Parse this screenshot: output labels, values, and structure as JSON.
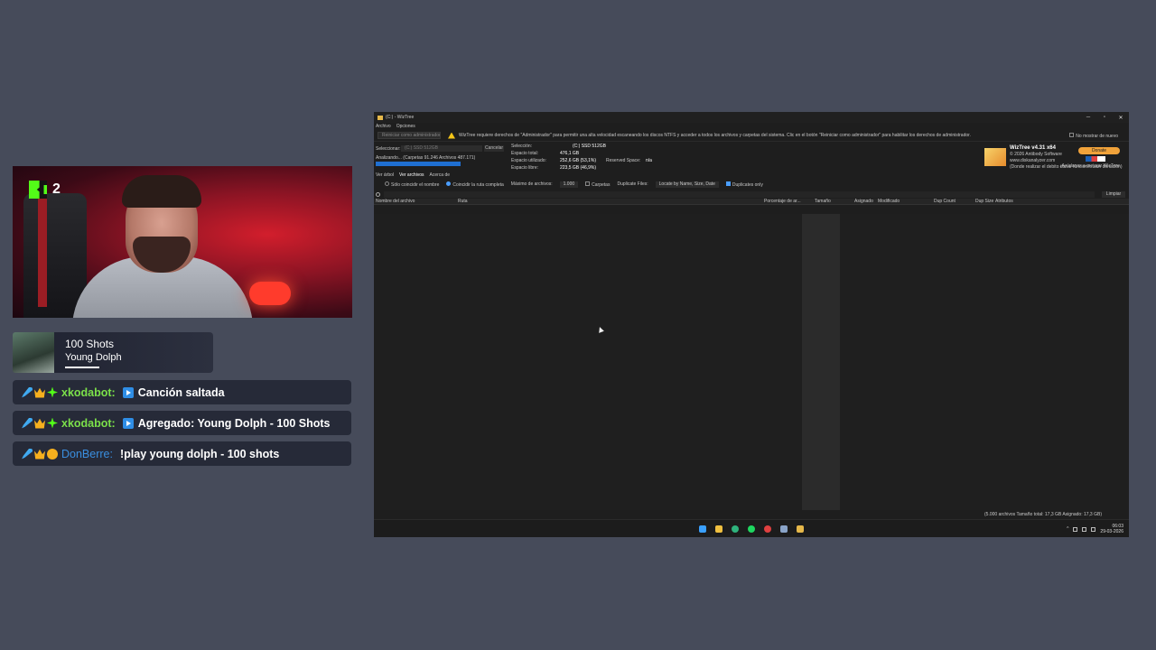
{
  "webcam": {
    "viewer_count": "2"
  },
  "now_playing": {
    "song": "100 Shots",
    "artist": "Young Dolph"
  },
  "chat": [
    {
      "user": "xkodabot:",
      "user_color": "#7be04a",
      "message": "Canción saltada",
      "icon": "skip-icon"
    },
    {
      "user": "xkodabot:",
      "user_color": "#7be04a",
      "message": "Agregado: Young Dolph - 100 Shots",
      "icon": "play-icon"
    },
    {
      "user": "DonBerre:",
      "user_color": "#3a8fe0",
      "message": "!play young dolph - 100 shots",
      "icon": ""
    }
  ],
  "window": {
    "title": "(C:) - WizTree",
    "drive_label": "(C:)",
    "app_name": "WizTree",
    "menu": [
      "Archivo",
      "Opciones"
    ],
    "admin_button": "Reiniciar como administrador",
    "admin_warning": "WizTree requiere derechos de \"Administrador\" para permitir una alta velocidad escaneando los discos NTFS y acceder a todos los archivos y carpetas del sistema. Clic en el botón \"Reiniciar como administrador\" para habilitar los derechos de administrador.",
    "no_show": "No mostrar de nuevo",
    "info": {
      "select_label": "Seleccionar:",
      "select_value": "(C:) SSD 512GB",
      "cancel": "Cancelar",
      "analyzing": "Analizando... (Carpetas 91.246 Archivos 487.171)",
      "scan_progress": 1,
      "selection_label": "Selección:",
      "selection_value": "(C:)   SSD 512GB",
      "total_label": "Espacio total:",
      "total_value": "476,1 GB",
      "used_label": "Espacio utilizado:",
      "used_value": "252,6 GB  (53,1%)",
      "free_label": "Espacio libre:",
      "free_value": "223,5 GB  (46,9%)",
      "reserved_label": "Reserved Space:",
      "reserved_value": "n/a"
    },
    "brand": {
      "name": "WizTree v4.31 x64",
      "copyright": "© 2026 Antibody Software",
      "url": "www.diskanalyzer.com",
      "donate": "Donate",
      "help_text": "¡Ayúdanos a mejorar WizTree",
      "support_note": "(Donde realizar el debito donar funciones aun donación)"
    },
    "view_tabs": [
      "Ver árbol",
      "Ver archivos",
      "Acerca de"
    ],
    "filters": {
      "name_only": "Sólo coincidir el nombre",
      "full_path": "Coincidir la ruta completa",
      "max_files_label": "Máximo de archivos:",
      "max_files_value": "1.000",
      "folders": "Carpetas",
      "dup_label": "Duplicate Files:",
      "dup_value": "Locate by Name, Size, Date",
      "dup_only": "Duplicates only"
    },
    "clear": "Limpiar",
    "columns": [
      "Nombre del archivo",
      "Ruta",
      "Porcentaje de ar...",
      "Tamaño",
      "Asignado",
      "Modificado",
      "Dup Count",
      "Dup Size",
      "Atributos"
    ],
    "status": "(5.000 archivos  Tamaño total: 17,3 GB  Asignado: 17,3 GB)",
    "clock_time": "06:03",
    "clock_date": "29-03-2026"
  }
}
